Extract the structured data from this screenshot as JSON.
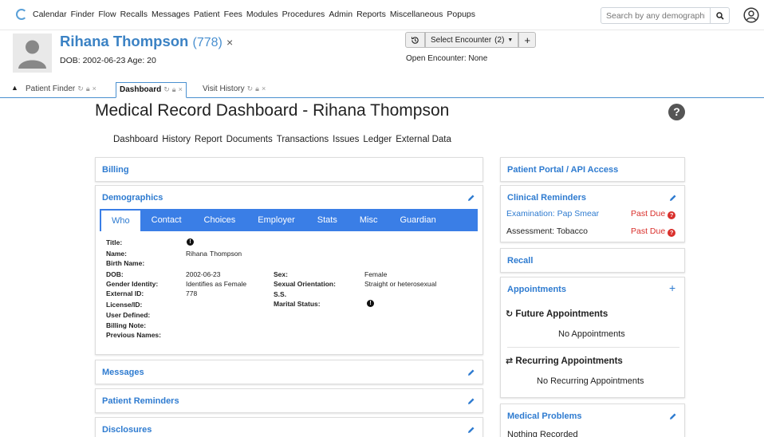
{
  "nav": {
    "menu": [
      "Calendar",
      "Finder",
      "Flow",
      "Recalls",
      "Messages",
      "Patient",
      "Fees",
      "Modules",
      "Procedures",
      "Admin",
      "Reports",
      "Miscellaneous",
      "Popups"
    ],
    "search_placeholder": "Search by any demographics"
  },
  "patient": {
    "name": "Rihana Thompson",
    "pid": "(778)",
    "close": "×",
    "dob_line": "DOB: 2002-06-23 Age: 20"
  },
  "encounter": {
    "select_label": "Select Encounter",
    "count": "(2)",
    "open_line": "Open Encounter: None"
  },
  "tabs": [
    {
      "label": "Patient Finder",
      "active": false
    },
    {
      "label": "Dashboard",
      "active": true
    },
    {
      "label": "Visit History",
      "active": false
    }
  ],
  "dashboard": {
    "title": "Medical Record Dashboard - Rihana Thompson",
    "subnav": [
      "Dashboard",
      "History",
      "Report",
      "Documents",
      "Transactions",
      "Issues",
      "Ledger",
      "External Data"
    ]
  },
  "left_cards": {
    "billing": "Billing",
    "demographics": "Demographics",
    "messages": "Messages",
    "patient_reminders": "Patient Reminders",
    "disclosures": "Disclosures"
  },
  "demo_tabs": [
    "Who",
    "Contact",
    "Choices",
    "Employer",
    "Stats",
    "Misc",
    "Guardian"
  ],
  "who": {
    "title_label": "Title:",
    "name_label": "Name:",
    "first_name": "Rihana",
    "last_name": "Thompson",
    "birth_name_label": "Birth Name:",
    "dob_label": "DOB:",
    "dob": "2002-06-23",
    "gender_label": "Gender Identity:",
    "gender": "Identifies as Female",
    "extid_label": "External ID:",
    "extid": "778",
    "license_label": "License/ID:",
    "user_defined_label": "User Defined:",
    "billing_note_label": "Billing Note:",
    "prev_names_label": "Previous Names:",
    "sex_label": "Sex:",
    "sex": "Female",
    "orientation_label": "Sexual Orientation:",
    "orientation": "Straight or heterosexual",
    "ss_label": "S.S.",
    "marital_label": "Marital Status:"
  },
  "right_cards": {
    "portal": "Patient Portal / API Access",
    "clinical_reminders": "Clinical Reminders",
    "recall": "Recall",
    "appointments": "Appointments",
    "medical_problems": "Medical Problems"
  },
  "reminders": [
    {
      "label": "Examination: Pap Smear",
      "status": "Past Due"
    },
    {
      "label": "Assessment: Tobacco",
      "status": "Past Due"
    }
  ],
  "appointments": {
    "future_heading": "Future Appointments",
    "future_empty": "No Appointments",
    "recurring_heading": "Recurring Appointments",
    "recurring_empty": "No Recurring Appointments"
  },
  "medical_problems": {
    "empty": "Nothing Recorded"
  },
  "colors": {
    "accent": "#2e7bd0",
    "tab_blue": "#3a7ee6",
    "past_due": "#d9302c"
  }
}
